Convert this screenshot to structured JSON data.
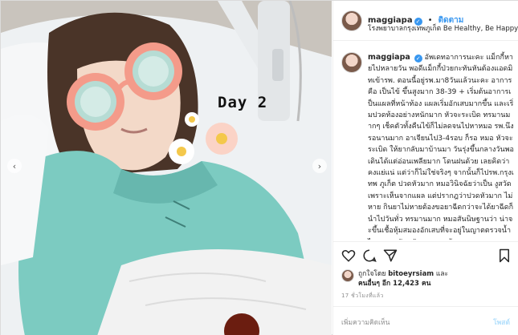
{
  "header": {
    "username": "maggiapa",
    "separator": "•",
    "follow_label": "ติดตาม",
    "location": "โรงพยาบาลกรุงเทพภูเก็ต Be Healthy, Be Happy"
  },
  "photo": {
    "caption_text": "Day 2",
    "prev_arrow": "‹",
    "next_arrow": "›"
  },
  "caption": {
    "username": "maggiapa",
    "text": "อัพเดทอาการนะคะ แม็กกี้หายไปหลายวัน พอดีแม็กกี้ป่วยกะทันหันต้องแอดมิทเข้ารพ. ตอนนี้อยู่รพ.มา8วันแล้วนะคะ อาการคือ เป็นไข้ ขึ้นสูงมาก 38-39 + เริ่มต้นอาการเป็นแผลที่หน้าท้อง แผลเริ่มอักเสบมากขึ้น และเริ่มปวดท้องอย่างหนักมาก หัวจะระเบิด ทรมานมากๆ เช็คตัวทั้งคืนไข้ก็ไม่ลดจนไปหาหมอ รพ.นึง รอนานมาก อาเจียนไป3-4รอบ ก็รอ หมอ หัวจะระเบิด ให้ยากลับมาบ้านมา วันรุ่งขึ้นกลางวันพอเดินได้แต่อ่อนเพลียมาก โดนฝนด้วย เลยคิดว่าคงแย่แน่ แต่ว่าก็ไม่ใช่จริงๆ จากนั้นก็ไปรพ.กรุงเทพ ภูเก็ต ปวดหัวมาก หมอวินิจฉัยว่าเป็น งูสวัด เพราะเห็นจากแผล แต่ปรากฎว่าปวดหัวมาก ไม่หาย กินยาไม่หายต้องขอยาฉีดกว่าจะได้ยาฉีดก็นำไปวันทั่ว ทรมานมาก หมอสันนิษฐานว่า น่าจะขึ้นเชื้อหุ้มสมองอักเสบที่จะอยู่ในญาตตรวจน้ำไขกระดูกสันหลังมาตรวจ ต้องลง"
  },
  "likes": {
    "prefix": "ถูกใจโดย",
    "liker": "bitoeyrsiam",
    "and_label": "และ",
    "others_prefix": "คนอื่นๆ อีก",
    "others_count": "12,423",
    "others_suffix": "คน"
  },
  "timestamp": "17 ชั่วโมงที่แล้ว",
  "add_comment": {
    "placeholder": "เพิ่มความคิดเห็น",
    "post_label": "โพสต์"
  },
  "icons": {
    "like": "heart-icon",
    "comment": "comment-icon",
    "share": "share-icon",
    "save": "bookmark-icon",
    "verified": "verified-badge-icon"
  },
  "colors": {
    "accent": "#3897f0",
    "post_disabled": "#b2dffc",
    "muted": "#8e8e8e"
  }
}
